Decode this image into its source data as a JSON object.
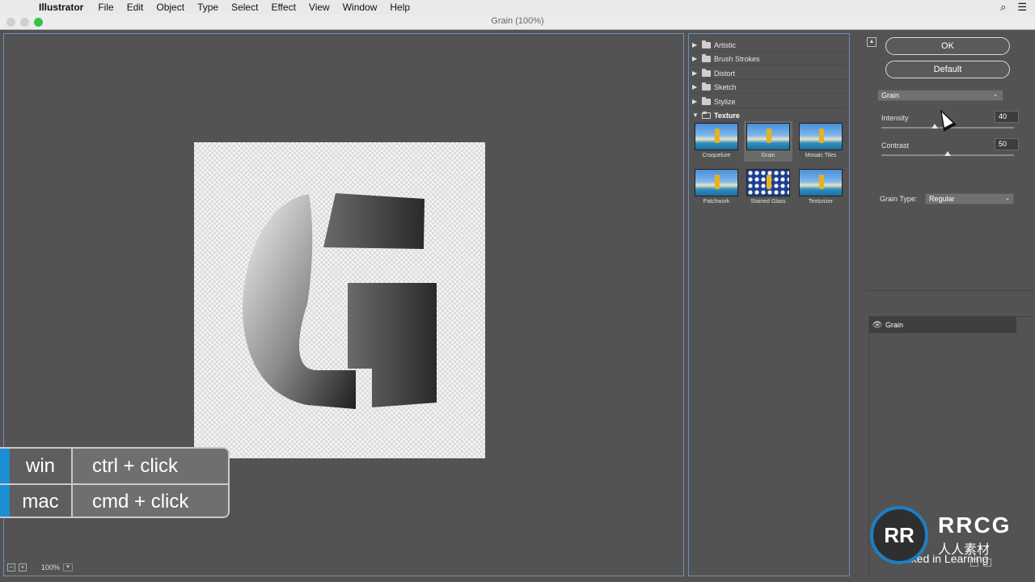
{
  "menubar": {
    "app": "Illustrator",
    "items": [
      "File",
      "Edit",
      "Object",
      "Type",
      "Select",
      "Effect",
      "View",
      "Window",
      "Help"
    ]
  },
  "window": {
    "title": "Grain (100%)"
  },
  "preview": {
    "zoom": "100%"
  },
  "shortcut": {
    "win_label": "win",
    "win_keys": "ctrl + click",
    "mac_label": "mac",
    "mac_keys": "cmd + click"
  },
  "gallery": {
    "categories": [
      "Artistic",
      "Brush Strokes",
      "Distort",
      "Sketch",
      "Stylize",
      "Texture"
    ],
    "texture_filters": [
      "Craquelure",
      "Grain",
      "Mosaic Tiles",
      "Patchwork",
      "Stained Glass",
      "Texturizer"
    ],
    "selected": "Grain"
  },
  "settings": {
    "ok_label": "OK",
    "default_label": "Default",
    "filter": "Grain",
    "intensity_label": "Intensity",
    "intensity_value": "40",
    "intensity_fraction": 0.4,
    "contrast_label": "Contrast",
    "contrast_value": "50",
    "contrast_fraction": 0.5,
    "grain_type_label": "Grain Type:",
    "grain_type_value": "Regular"
  },
  "layers": {
    "effect_layer": "Grain"
  },
  "branding": {
    "rrcg": "RRCG",
    "rrcg_sub": "人人素材",
    "linkedin": "Linked in Learning",
    "circle": "RR"
  },
  "colors": {
    "accent": "#1b8fd1",
    "panel": "#535353",
    "selection_border": "#6d8fb8"
  }
}
